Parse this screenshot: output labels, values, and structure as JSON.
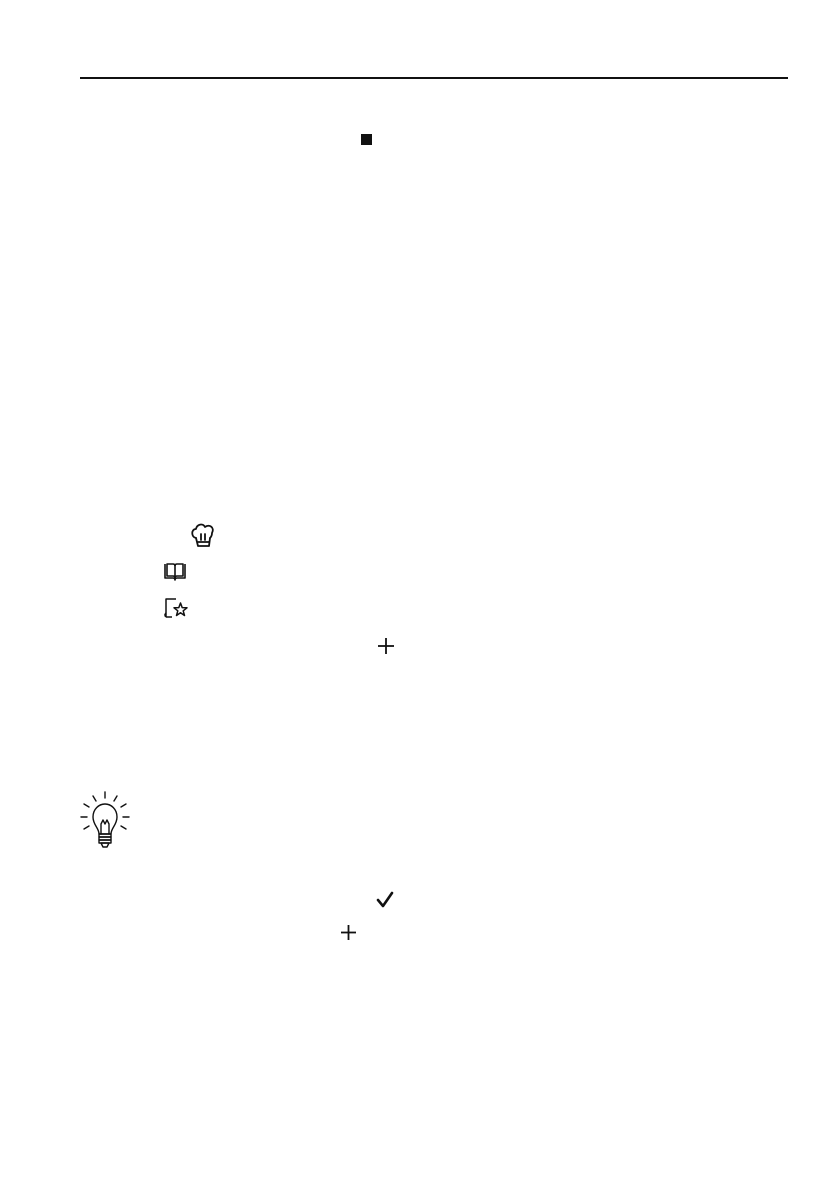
{
  "page": {
    "header_rule": true
  },
  "icons": {
    "stop": "stop-square-icon",
    "chef_hat": "chef-hat-icon",
    "book": "recipe-book-icon",
    "favourites": "favourites-star-icon",
    "plus_first": "plus-icon",
    "tip": "lightbulb-icon",
    "confirm": "checkmark-icon",
    "plus_second": "plus-icon"
  },
  "colors": {
    "ink": "#111111",
    "background": "#ffffff"
  }
}
